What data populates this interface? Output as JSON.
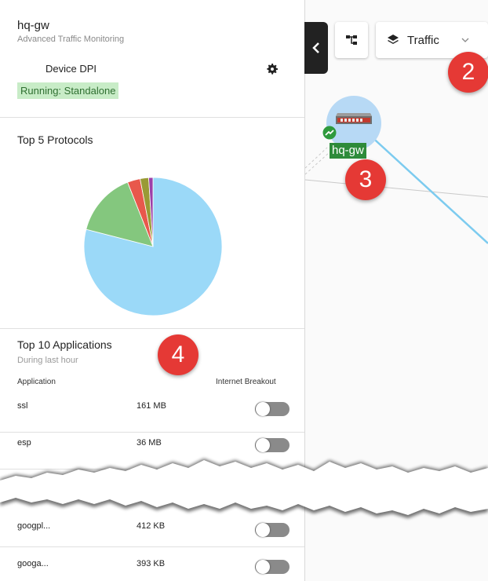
{
  "device": {
    "name": "hq-gw",
    "subtitle": "Advanced Traffic Monitoring",
    "dpi_label": "Device DPI",
    "status": "Running: Standalone"
  },
  "protocols": {
    "title": "Top 5 Protocols"
  },
  "chart_data": {
    "type": "pie",
    "title": "Top 5 Protocols",
    "slices": [
      {
        "value": 79,
        "color": "#9bd9f8"
      },
      {
        "value": 15,
        "color": "#84c77e"
      },
      {
        "value": 3,
        "color": "#e8584c"
      },
      {
        "value": 2,
        "color": "#9a9a35"
      },
      {
        "value": 1,
        "color": "#9c3fa8"
      }
    ]
  },
  "applications": {
    "title": "Top 10 Applications",
    "subtitle": "During last hour",
    "col_app": "Application",
    "col_breakout": "Internet Breakout",
    "rows_top": [
      {
        "app": "ssl",
        "size": "161 MB"
      },
      {
        "app": "esp",
        "size": "36 MB"
      }
    ],
    "rows_bottom": [
      {
        "app": "googpl...",
        "size": "412 KB"
      },
      {
        "app": "googa...",
        "size": "393 KB"
      }
    ]
  },
  "map": {
    "layer_label": "Traffic",
    "node_label": "hq-gw"
  },
  "callouts": {
    "c2": "2",
    "c3": "3",
    "c4": "4"
  },
  "icons": {
    "gear": "gear-icon",
    "collapse": "chevron-left-icon",
    "topology": "topology-icon",
    "layers": "layers-icon",
    "dropdown": "chevron-down-icon",
    "device": "router-icon",
    "status": "trend-up-icon"
  }
}
